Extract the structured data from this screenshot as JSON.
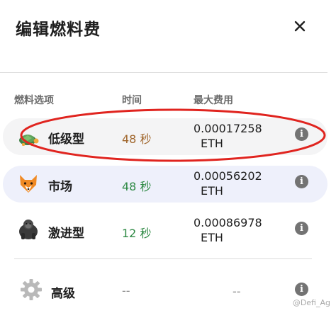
{
  "header": {
    "title": "编辑燃料费"
  },
  "columns": {
    "option": "燃料选项",
    "time": "时间",
    "max_fee": "最大费用"
  },
  "options": [
    {
      "label": "低级型",
      "time": "48 秒",
      "fee": "0.00017258",
      "unit": "ETH",
      "icon": "turtle-icon",
      "time_color": "#a0662c"
    },
    {
      "label": "市场",
      "time": "48 秒",
      "fee": "0.00056202",
      "unit": "ETH",
      "icon": "fox-icon",
      "time_color": "#2f8a45"
    },
    {
      "label": "激进型",
      "time": "12 秒",
      "fee": "0.00086978",
      "unit": "ETH",
      "icon": "gorilla-icon",
      "time_color": "#2f8a45"
    },
    {
      "label": "高级",
      "time": "--",
      "fee": "--",
      "unit": "",
      "icon": "gear-icon",
      "time_color": "#8a8a8a"
    }
  ],
  "annotation_color": "#e0241f",
  "watermark": "@Defi_Ag"
}
